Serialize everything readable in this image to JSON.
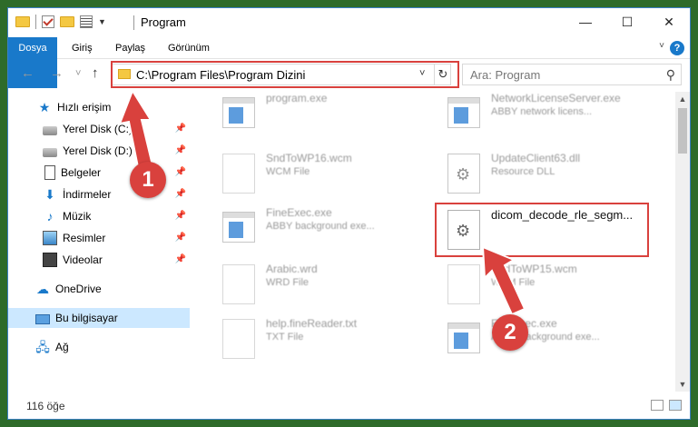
{
  "window": {
    "title": "Program",
    "minimize": "—",
    "maximize": "☐",
    "close": "✕"
  },
  "ribbon": {
    "tabs": [
      "Dosya",
      "Giriş",
      "Paylaş",
      "Görünüm"
    ],
    "help": "?"
  },
  "nav": {
    "back": "←",
    "forward": "→",
    "recent": "˅",
    "up": "↑",
    "address": "C:\\Program Files\\Program Dizini",
    "refresh": "↻",
    "search_placeholder": "Ara: Program"
  },
  "sidebar": {
    "items": [
      {
        "label": "Hızlı erişim",
        "icon": "star-icon"
      },
      {
        "label": "Yerel Disk (C:)",
        "icon": "disk-icon",
        "pinned": true
      },
      {
        "label": "Yerel Disk (D:)",
        "icon": "disk-icon",
        "pinned": true
      },
      {
        "label": "Belgeler",
        "icon": "document-icon",
        "pinned": true
      },
      {
        "label": "İndirmeler",
        "icon": "download-icon",
        "pinned": true
      },
      {
        "label": "Müzik",
        "icon": "music-icon",
        "pinned": true
      },
      {
        "label": "Resimler",
        "icon": "picture-icon",
        "pinned": true
      },
      {
        "label": "Videolar",
        "icon": "video-icon",
        "pinned": true
      },
      {
        "label": "OneDrive",
        "icon": "cloud-icon"
      },
      {
        "label": "Bu bilgisayar",
        "icon": "computer-icon",
        "selected": true
      },
      {
        "label": "Ağ",
        "icon": "network-icon"
      }
    ]
  },
  "files": [
    {
      "name": "program.exe",
      "type": "",
      "icon": "exe-icon"
    },
    {
      "name": "NetworkLicenseServer.exe",
      "type": "ABBY network licens...",
      "icon": "app-icon"
    },
    {
      "name": "SndToWP16.wcm",
      "type": "WCM File",
      "icon": "file-icon"
    },
    {
      "name": "UpdateClient63.dll",
      "type": "Resource DLL",
      "icon": "dll-icon"
    },
    {
      "name": "FineExec.exe",
      "type": "ABBY background exe...",
      "icon": "app-icon"
    },
    {
      "name": "dicom_decode_rle_segm...",
      "type": "",
      "icon": "gear-file-icon"
    },
    {
      "name": "Arabic.wrd",
      "type": "WRD File",
      "icon": "file-icon"
    },
    {
      "name": "SndToWP15.wcm",
      "type": "WCM File",
      "icon": "file-icon"
    },
    {
      "name": "help.fineReader.txt",
      "type": "TXT File",
      "icon": "file-icon"
    },
    {
      "name": "FineExec.exe",
      "type": "ABBY background exe...",
      "icon": "app-icon"
    }
  ],
  "status": {
    "count": "116 öğe"
  },
  "annotations": {
    "step1": "1",
    "step2": "2",
    "color": "#d9413d"
  }
}
